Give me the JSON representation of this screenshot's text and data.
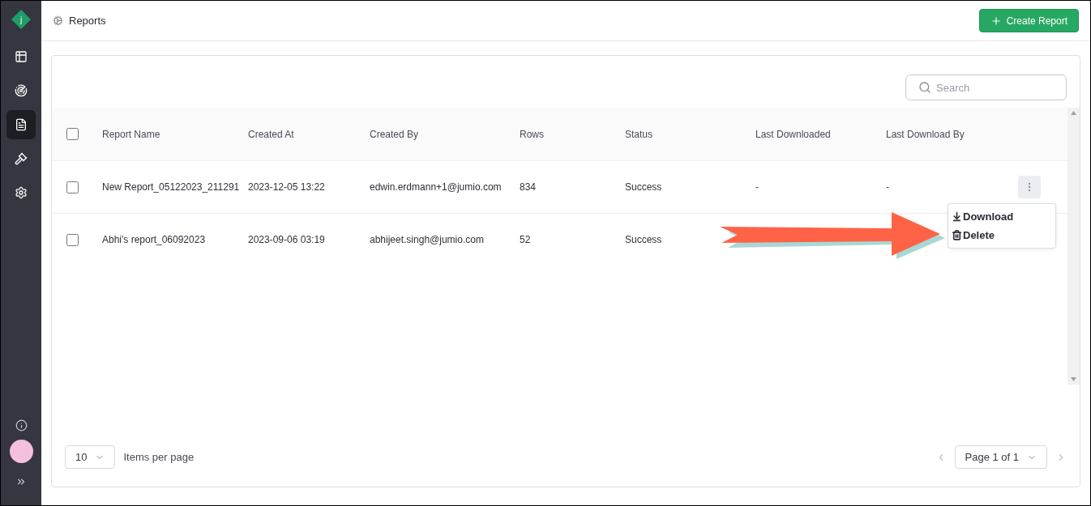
{
  "sidebar": {
    "logo": "j",
    "items": [
      {
        "kind": "table",
        "selected": false
      },
      {
        "kind": "radar",
        "selected": false
      },
      {
        "kind": "document",
        "selected": true
      },
      {
        "kind": "gavel",
        "selected": false
      },
      {
        "kind": "settings",
        "selected": false
      }
    ]
  },
  "header": {
    "title": "Reports",
    "create_button": "Create Report"
  },
  "search": {
    "placeholder": "Search"
  },
  "table": {
    "select_all": {
      "checked": false
    },
    "columns": [
      "Report Name",
      "Created At",
      "Created By",
      "Rows",
      "Status",
      "Last Downloaded",
      "Last Download By"
    ],
    "rows": [
      {
        "checked": false,
        "cells": [
          "New Report_05122023_211291",
          "2023-12-05 13:22",
          "edwin.erdmann+1@jumio.com",
          "834",
          "Success",
          "-",
          "-"
        ],
        "hovered": true
      },
      {
        "checked": false,
        "cells": [
          "Abhi's report_06092023",
          "2023-09-06 03:19",
          "abhijeet.singh@jumio.com",
          "52",
          "Success"
        ],
        "hovered": false
      }
    ],
    "row_menu": [
      "Download",
      "Delete"
    ]
  },
  "pagination": {
    "per_page": "10",
    "per_page_label": "Items per page",
    "page": "Page 1 of 1"
  }
}
